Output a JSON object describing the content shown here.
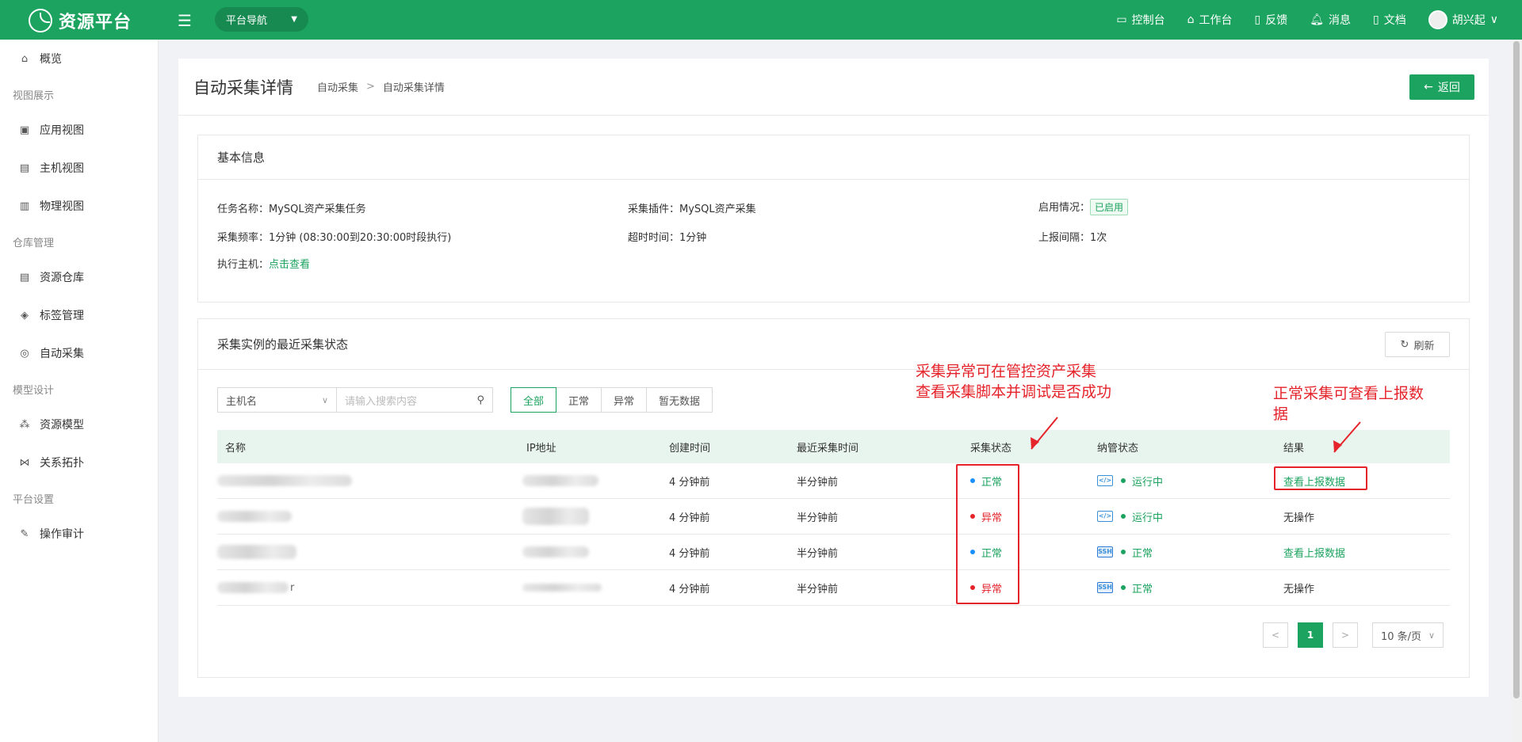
{
  "app": {
    "title": "资源平台",
    "nav_select": "平台导航"
  },
  "top_links": [
    {
      "icon": "monitor-icon",
      "glyph": "▭",
      "label": "控制台"
    },
    {
      "icon": "home-icon",
      "glyph": "⌂",
      "label": "工作台"
    },
    {
      "icon": "feedback-icon",
      "glyph": "▯",
      "label": "反馈"
    },
    {
      "icon": "bell-icon",
      "glyph": "♫",
      "label": "消息"
    },
    {
      "icon": "document-icon",
      "glyph": "▯",
      "label": "文档"
    }
  ],
  "user": {
    "name": "胡兴起"
  },
  "sidebar": {
    "overview": "概览",
    "group_view": "视图展示",
    "app_view": "应用视图",
    "host_view": "主机视图",
    "physical_view": "物理视图",
    "group_warehouse": "仓库管理",
    "resource_warehouse": "资源仓库",
    "tag_mgmt": "标签管理",
    "auto_collect": "自动采集",
    "group_model": "模型设计",
    "resource_model": "资源模型",
    "topology": "关系拓扑",
    "group_platform": "平台设置",
    "audit": "操作审计"
  },
  "page": {
    "title": "自动采集详情",
    "breadcrumb": [
      "自动采集",
      "自动采集详情"
    ],
    "breadcrumb_sep": ">",
    "back": "返回"
  },
  "basic": {
    "heading": "基本信息",
    "task_name_label": "任务名称：",
    "task_name": "MySQL资产采集任务",
    "plugin_label": "采集插件：",
    "plugin": "MySQL资产采集",
    "enabled_label": "启用情况：",
    "enabled": "已启用",
    "freq_label": "采集频率：",
    "freq": "1分钟 (08:30:00到20:30:00时段执行)",
    "timeout_label": "超时时间：",
    "timeout": "1分钟",
    "interval_label": "上报间隔：",
    "interval": "1次",
    "host_label": "执行主机：",
    "host_link": "点击查看"
  },
  "status_panel": {
    "heading": "采集实例的最近采集状态",
    "refresh": "刷新",
    "filter_field": "主机名",
    "search_placeholder": "请输入搜索内容",
    "tabs": [
      "全部",
      "正常",
      "异常",
      "暂无数据"
    ],
    "active_tab": "全部",
    "columns": [
      "名称",
      "IP地址",
      "创建时间",
      "最近采集时间",
      "采集状态",
      "纳管状态",
      "结果"
    ],
    "rows": [
      {
        "created": "4 分钟前",
        "last": "半分钟前",
        "status": "正常",
        "status_kind": "ok",
        "proto": "</>",
        "proto_kind": "code",
        "manage": "运行中",
        "result": "查看上报数据",
        "result_kind": "link"
      },
      {
        "created": "4 分钟前",
        "last": "半分钟前",
        "status": "异常",
        "status_kind": "err",
        "proto": "</>",
        "proto_kind": "code",
        "manage": "运行中",
        "result": "无操作",
        "result_kind": "text"
      },
      {
        "created": "4 分钟前",
        "last": "半分钟前",
        "status": "正常",
        "status_kind": "ok",
        "proto": "SSH",
        "proto_kind": "ssh",
        "manage": "正常",
        "result": "查看上报数据",
        "result_kind": "link"
      },
      {
        "created": "4 分钟前",
        "last": "半分钟前",
        "status": "异常",
        "status_kind": "err",
        "proto": "SSH",
        "proto_kind": "ssh",
        "manage": "正常",
        "result": "无操作",
        "result_kind": "text"
      }
    ],
    "row_name_tails": [
      "",
      "",
      "",
      "r"
    ],
    "pager": {
      "prev": "<",
      "page": "1",
      "next": ">",
      "size": "10 条/页"
    }
  },
  "annotations": {
    "abnormal_note": "采集异常可在管控资产采集\n查看采集脚本并调试是否成功",
    "normal_note": "正常采集可查看上报数",
    "normal_note_2": "据"
  },
  "colors": {
    "brand": "#1ca35f",
    "ok_dot": "#1890ff",
    "err": "#e5232a"
  }
}
